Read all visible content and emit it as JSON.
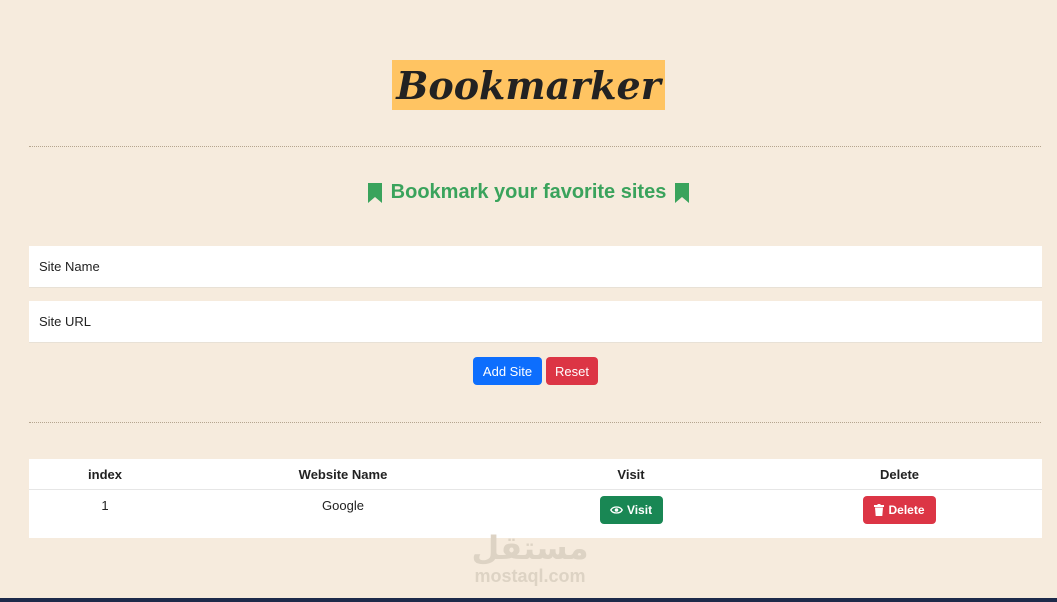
{
  "header": {
    "title": "Bookmarker"
  },
  "subtitle": {
    "text": "Bookmark your favorite sites",
    "icon": "bookmark-icon",
    "color": "#3aa35c"
  },
  "form": {
    "site_name_placeholder": "Site Name",
    "site_url_placeholder": "Site URL",
    "add_label": "Add Site",
    "reset_label": "Reset"
  },
  "table": {
    "headers": {
      "index": "index",
      "name": "Website Name",
      "visit": "Visit",
      "delete": "Delete"
    },
    "rows": [
      {
        "index": "1",
        "name": "Google",
        "visit_label": "Visit",
        "delete_label": "Delete"
      }
    ]
  },
  "watermark": {
    "arabic": "مستقل",
    "latin": "mostaql.com"
  },
  "colors": {
    "background": "#f6ebdd",
    "title_highlight": "#ffc462",
    "primary": "#0d6efd",
    "danger": "#dc3545",
    "success": "#198754"
  }
}
